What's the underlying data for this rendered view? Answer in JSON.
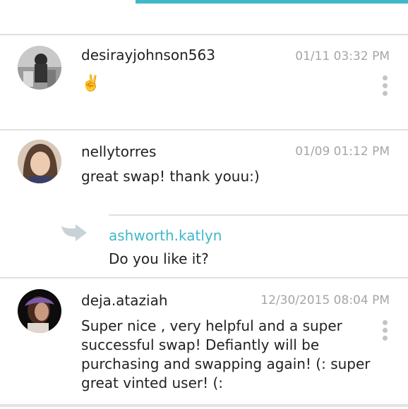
{
  "comments": [
    {
      "username": "desirayjohnson563",
      "timestamp": "01/11 03:32 PM",
      "text": "✌️",
      "avatar_icon": "user-photo"
    },
    {
      "username": "nellytorres",
      "timestamp": "01/09 01:12 PM",
      "text": "great swap! thank youu:)",
      "avatar_icon": "user-photo",
      "reply": {
        "username": "ashworth.katlyn",
        "text": "Do you like it?",
        "icon": "reply-arrow-icon"
      }
    },
    {
      "username": "deja.ataziah",
      "timestamp": "12/30/2015 08:04 PM",
      "text_lines": [
        "Super nice , very helpful and a super",
        "successful swap! Defiantly will be",
        "purchasing and swapping again! (: super",
        "great vinted user! (:"
      ],
      "avatar_icon": "user-photo"
    }
  ],
  "colors": {
    "accent": "#3fb8c8",
    "divider": "#e0e0e0",
    "timestamp": "#a6a6a6",
    "more_dots": "#c4c4c4"
  }
}
